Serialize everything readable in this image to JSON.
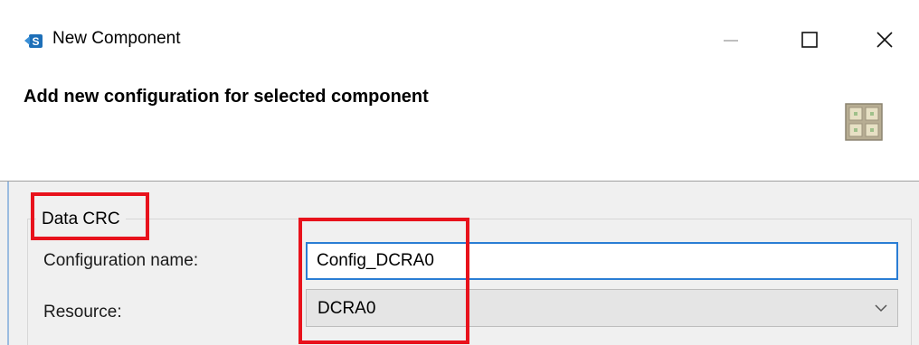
{
  "window": {
    "title": "New Component",
    "controls": {
      "minimize": "minimize-icon",
      "maximize": "maximize-icon",
      "close": "close-icon"
    }
  },
  "banner": {
    "title": "Add new configuration for selected component",
    "icon": "component-grid-icon"
  },
  "group": {
    "label": "Data CRC"
  },
  "form": {
    "config_name_label": "Configuration name:",
    "config_name_value": "Config_DCRA0",
    "resource_label": "Resource:",
    "resource_value": "DCRA0"
  },
  "colors": {
    "accent": "#2a7dd4",
    "highlight": "#e8121c",
    "panel_bg": "#f0f0f0"
  }
}
